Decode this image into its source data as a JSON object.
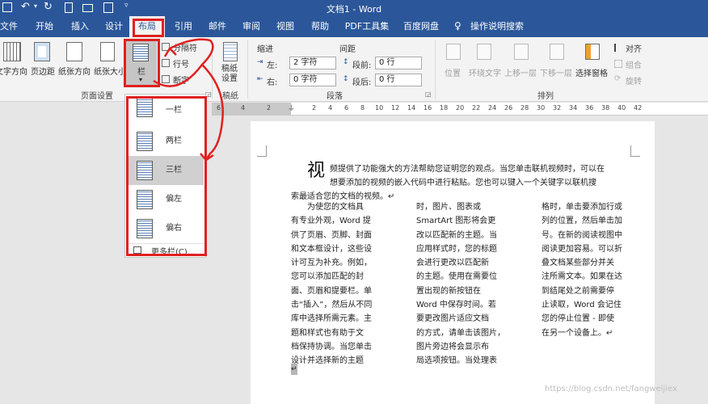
{
  "titlebar": {
    "title": "文档1 - Word"
  },
  "tabs": [
    "文件",
    "开始",
    "插入",
    "设计",
    "布局",
    "引用",
    "邮件",
    "审阅",
    "视图",
    "帮助",
    "PDF工具集",
    "百度网盘",
    "操作说明搜索"
  ],
  "ribbon": {
    "page_setup": {
      "text_direction": "文字方向",
      "margins": "页边距",
      "orientation": "纸张方向",
      "size": "纸张大小",
      "columns": "栏",
      "breaks": "分隔符",
      "line_numbers": "行号",
      "hyphenation": "断字",
      "group_label": "页面设置"
    },
    "draft": {
      "label": "稿纸设置",
      "group_label": "稿纸"
    },
    "paragraph": {
      "indent_header": "缩进",
      "spacing_header": "间距",
      "left_label": "左:",
      "right_label": "右:",
      "before_label": "段前:",
      "after_label": "段后:",
      "left_value": "2 字符",
      "right_value": "0 字符",
      "before_value": "0 行",
      "after_value": "0 行",
      "group_label": "段落"
    },
    "arrange": {
      "position": "位置",
      "wrap_text": "环绕文字",
      "bring_forward": "上移一层",
      "send_backward": "下移一层",
      "selection_pane": "选择窗格",
      "align": "对齐",
      "group": "组合",
      "rotate": "旋转",
      "group_label": "排列"
    }
  },
  "columns_menu": {
    "items": [
      "一栏",
      "两栏",
      "三栏",
      "偏左",
      "偏右"
    ],
    "selected": "三栏",
    "more": "更多栏(C)..."
  },
  "ruler": {
    "numbers": [
      "6",
      "4",
      "2",
      "2",
      "4",
      "6",
      "8",
      "10",
      "12",
      "14",
      "16",
      "18",
      "20",
      "22",
      "24",
      "26",
      "28",
      "30",
      "32",
      "34",
      "36",
      "38",
      "40",
      "42"
    ]
  },
  "document": {
    "dropcap": "视",
    "intro_line1": "频提供了功能强大的方法帮助您证明您的观点。当您单击联机视频时，可以在",
    "intro_line2": "想要添加的视频的嵌入代码中进行粘贴。您也可以键入一个关键字以联机搜",
    "intro_line3": "索最适合您的文档的视频。↵",
    "col1": "　　为使您的文档具\n有专业外观，Word 提\n供了页眉、页脚、封面\n和文本框设计，这些设\n计可互为补充。例如，\n您可以添加匹配的封\n面、页眉和提要栏。单\n击“插入”，然后从不同\n库中选择所需元素。主\n题和样式也有助于文\n档保持协调。当您单击\n设计并选择新的主题",
    "col2": "时，图片、图表或\nSmartArt 图形将会更\n改以匹配新的主题。当\n应用样式时，您的标题\n会进行更改以匹配新\n的主题。使用在需要位\n置出现的新按钮在\nWord 中保存时间。若\n要更改图片适应文档\n的方式，请单击该图片，\n图片旁边将会显示布\n局选项按钮。当处理表",
    "col3": "格时，单击要添加行或\n列的位置，然后单击加\n号。在新的阅读视图中\n阅读更加容易。可以折\n叠文档某些部分并关\n注所需文本。如果在达\n到结尾处之前需要停\n止读取，Word 会记住\n您的停止位置 - 即使\n在另一个设备上。↵"
  },
  "watermark": "https://blog.csdn.net/fangweijiex"
}
